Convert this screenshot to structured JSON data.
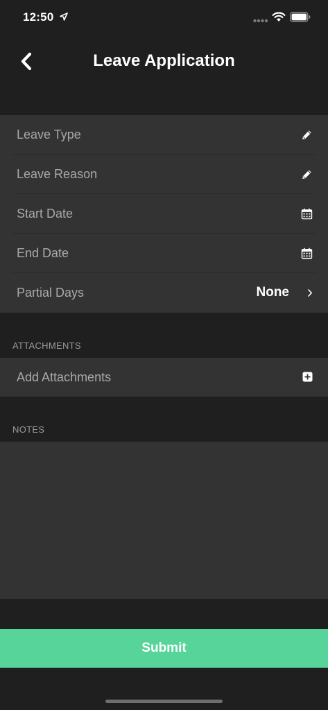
{
  "status_bar": {
    "time": "12:50"
  },
  "header": {
    "title": "Leave Application"
  },
  "form": {
    "rows": [
      {
        "label": "Leave Type",
        "icon": "pencil-icon"
      },
      {
        "label": "Leave Reason",
        "icon": "pencil-icon"
      },
      {
        "label": "Start Date",
        "icon": "calendar-icon"
      },
      {
        "label": "End Date",
        "icon": "calendar-icon"
      },
      {
        "label": "Partial Days",
        "value": "None",
        "icon": "chevron-right-icon"
      }
    ]
  },
  "attachments": {
    "section_title": "ATTACHMENTS",
    "add_label": "Add Attachments",
    "icon": "plus-square-icon"
  },
  "notes": {
    "section_title": "NOTES",
    "value": ""
  },
  "actions": {
    "submit_label": "Submit"
  },
  "colors": {
    "background": "#1f1f1f",
    "cell_background": "#333333",
    "accent": "#57d49a",
    "label_text": "#a9a9a9"
  }
}
